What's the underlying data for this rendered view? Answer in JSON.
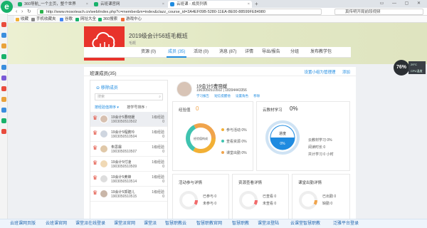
{
  "browser": {
    "tabs": [
      {
        "label": "360导航_一个主页，整个世界",
        "active": false,
        "color": "#19b26b"
      },
      {
        "label": "云班课官网",
        "active": false,
        "color": "#19b26b"
      },
      {
        "label": "云班课 - 成员列表",
        "active": true,
        "color": "#1f8be0"
      }
    ],
    "new_tab": "+",
    "window_controls": "▭ — ▢ ✕",
    "url": "http://www.mosoteach.cn/web/index.php?c=member&m=index&clazz_course_id=3A4EF09B-5280-11EA-8E00-88599FE84980",
    "search_placeholder": "真传明开局前段视频",
    "bookmarks": [
      "收藏",
      "手机收藏夹",
      "谷歌",
      "网址大全",
      "360搜索",
      "游戏中心"
    ]
  },
  "course": {
    "title": "2019级会计56班毛概班",
    "subtitle": "毛概"
  },
  "page_tabs": [
    "资源 (0)",
    "成员 (35)",
    "活动 (0)",
    "消息 (87)",
    "详情",
    "导出/报告",
    "分组",
    "发布教学包"
  ],
  "panel": {
    "title": "班课成员(35)",
    "actions": [
      "设置小组为管理理",
      "添加"
    ]
  },
  "student_list": {
    "remove_label": "移除成员",
    "search_placeholder": "搜索",
    "sort_primary": "按经验值排序 ▾",
    "sort_secondary": "按学号排序 ↑",
    "rows": [
      {
        "name": "19会计5曹晓媛",
        "id": "1903050510502",
        "level": "1级经验",
        "score": "0"
      },
      {
        "name": "19会计5程鹏玲",
        "id": "1903050510504",
        "level": "1级经验",
        "score": "0"
      },
      {
        "name": "朱思霖",
        "id": "1903050510507",
        "level": "1级经验",
        "score": "0"
      },
      {
        "name": "19会计5付凌",
        "id": "1903050510509",
        "level": "1级经验",
        "score": "0"
      },
      {
        "name": "19会计5黄锋",
        "id": "1903050510514",
        "level": "1级经验",
        "score": "0"
      },
      {
        "name": "19会计5郭建儿",
        "id": "1903050510515",
        "level": "1级经验",
        "score": "0"
      }
    ]
  },
  "detail": {
    "name": "19会计5曹晓媛",
    "id_phone": "1903050510502 | 18394443356",
    "links": [
      "学习报告",
      "短信提醒他",
      "设置角色",
      "移除"
    ],
    "exp_card": {
      "title": "经验值",
      "value": "0",
      "ring_label": "经验值构成",
      "legend": [
        {
          "label": "参与活动",
          "value": "0%",
          "color": "#f2b035"
        },
        {
          "label": "查看资源",
          "value": "0%",
          "color": "#3fc3b0"
        },
        {
          "label": "课堂出勤",
          "value": "0%",
          "color": "#f0a44c"
        }
      ]
    },
    "progress_card": {
      "title": "云教材学习",
      "value": "0%",
      "gauge_label": "进度",
      "gauge_value": "0%",
      "stats": [
        {
          "label": "云教材学习",
          "value": "0%"
        },
        {
          "label": "阅读时长",
          "value": "0"
        },
        {
          "label": "共计学习",
          "value": "0 小时"
        }
      ]
    },
    "small_cards": [
      {
        "title": "活动参与详情",
        "lines": [
          "已参与 0",
          "未参与 0"
        ],
        "color": "#f26b6b"
      },
      {
        "title": "资源查看详情",
        "lines": [
          "已查看 0",
          "未查看 0"
        ],
        "color": "#f26b6b"
      },
      {
        "title": "课堂出勤详情",
        "lines": [
          "已出勤 0",
          "缺勤 0"
        ],
        "color": "#f0a44c"
      }
    ]
  },
  "speed_widget": {
    "value": "76%",
    "line1": "29°C",
    "line2": "CPU温度"
  },
  "bottom_links": [
    "云班课网页版",
    "云班课官网",
    "课堂派在线登录",
    "课堂派官网",
    "课堂派",
    "智慧职教云",
    "智慧职教官网",
    "智慧职教",
    "课堂派登陆",
    "云课堂智慧职教",
    "泛雅平台登录"
  ]
}
